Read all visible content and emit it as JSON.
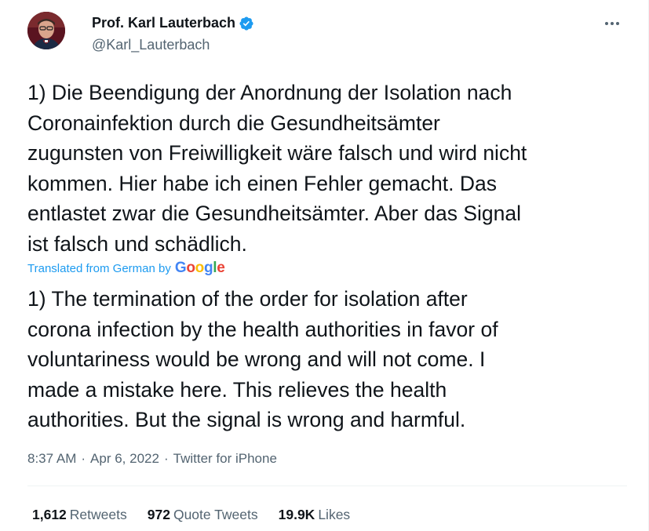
{
  "author": {
    "display_name": "Prof. Karl Lauterbach",
    "handle": "@Karl_Lauterbach",
    "verified": true
  },
  "tweet": {
    "text": "1) Die Beendigung der Anordnung der Isolation nach\nCoronainfektion durch die Gesundheitsämter\nzugunsten von Freiwilligkeit wäre falsch und wird nicht\nkommen. Hier habe ich einen Fehler gemacht. Das\nentlastet zwar die Gesundheitsämter. Aber das Signal\nist falsch und schädlich.",
    "translated_label": "Translated from German by",
    "translator_logo": "Google",
    "translation": "1) The termination of the order for isolation after\ncorona infection by the health authorities in favor of\nvoluntariness would be wrong and will not come. I\nmade a mistake here. This relieves the health\nauthorities. But the signal is wrong and harmful.",
    "time": "8:37 AM",
    "date": "Apr 6, 2022",
    "source": "Twitter for iPhone",
    "separator": "·"
  },
  "stats": {
    "retweets_count": "1,612",
    "retweets_label": "Retweets",
    "quotes_count": "972",
    "quotes_label": "Quote Tweets",
    "likes_count": "19.9K",
    "likes_label": "Likes"
  },
  "colors": {
    "accent": "#1d9bf0",
    "text": "#0f1419",
    "secondary": "#536471"
  },
  "icons": {
    "verified": "verified-badge-icon",
    "more": "more-options-icon"
  }
}
